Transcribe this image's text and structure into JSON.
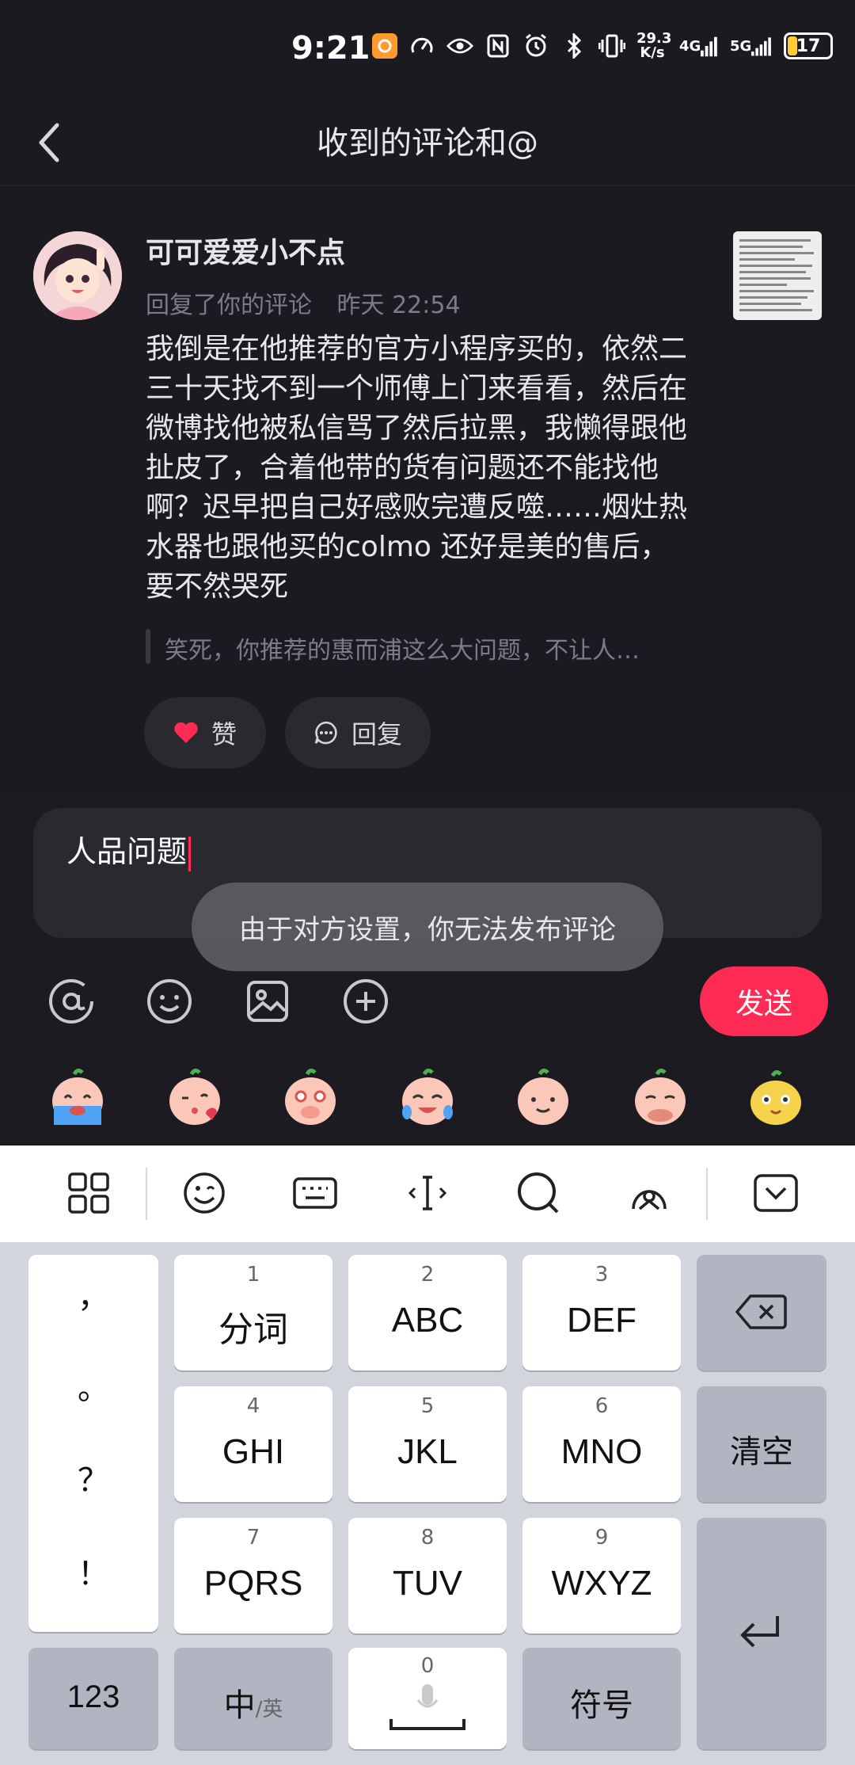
{
  "status_bar": {
    "time": "9:21",
    "net_speed_value": "29.3",
    "net_speed_unit": "K/s",
    "signal_1": "4G",
    "signal_2": "5G",
    "battery": "17",
    "icons": [
      "app-badge-icon",
      "speedometer-icon",
      "eye-icon",
      "nfc-icon",
      "alarm-icon",
      "bluetooth-icon",
      "vibrate-icon"
    ]
  },
  "header": {
    "title": "收到的评论和@"
  },
  "comment": {
    "username": "可可爱爱小不点",
    "action": "回复了你的评论",
    "time": "昨天 22:54",
    "body": "我倒是在他推荐的官方小程序买的，依然二三十天找不到一个师傅上门来看看，然后在微博找他被私信骂了然后拉黑，我懒得跟他扯皮了，合着他带的货有问题还不能找他啊？迟早把自己好感败完遭反噬……烟灶热水器也跟他买的colmo 还好是美的售后，要不然哭死",
    "quote": "笑死，你推荐的惠而浦这么大问题，不让人…",
    "like_label": "赞",
    "reply_label": "回复"
  },
  "composer": {
    "input_value": "人品问题",
    "toast": "由于对方设置，你无法发布评论",
    "send_label": "发送",
    "tools": [
      "at-icon",
      "smile-icon",
      "image-icon",
      "plus-icon"
    ]
  },
  "keyboard": {
    "punctuation": [
      "，",
      "。",
      "？",
      "！"
    ],
    "keys": [
      {
        "num": "1",
        "label": "分词"
      },
      {
        "num": "2",
        "label": "ABC"
      },
      {
        "num": "3",
        "label": "DEF"
      },
      {
        "num": "4",
        "label": "GHI"
      },
      {
        "num": "5",
        "label": "JKL"
      },
      {
        "num": "6",
        "label": "MNO"
      },
      {
        "num": "7",
        "label": "PQRS"
      },
      {
        "num": "8",
        "label": "TUV"
      },
      {
        "num": "9",
        "label": "WXYZ"
      }
    ],
    "clear_label": "清空",
    "num_label": "123",
    "lang_main": "中",
    "lang_sub": "/英",
    "space_num": "0",
    "symbol_label": "符号"
  },
  "colors": {
    "background": "#1b1a20",
    "accent": "#fe2c55",
    "like": "#fe2c55"
  }
}
